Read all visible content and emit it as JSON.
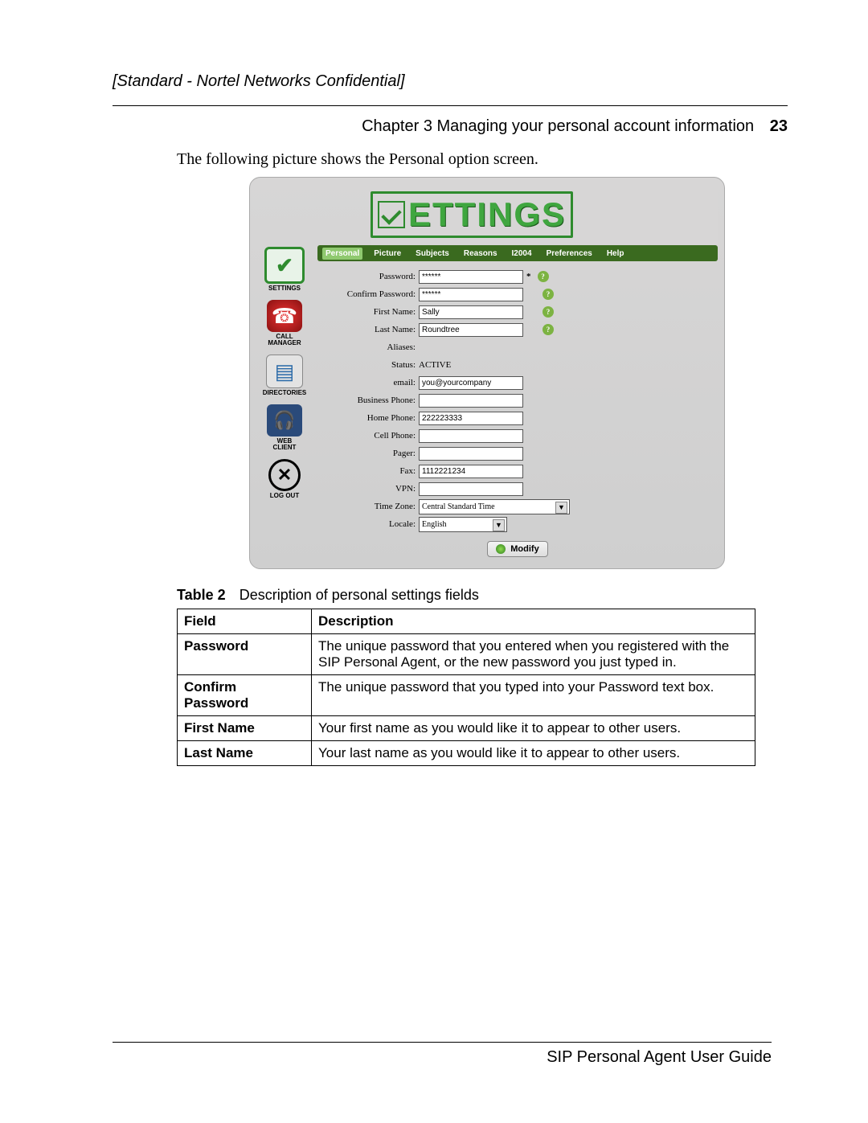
{
  "header": {
    "confidential": "[Standard - Nortel Networks Confidential]",
    "chapter_line": "Chapter 3  Managing your personal account information",
    "page_number": "23"
  },
  "intro": "The following picture shows the Personal option screen.",
  "logo_text": "ETTINGS",
  "sidebar": [
    {
      "label": "SETTINGS"
    },
    {
      "label": "CALL\nMANAGER"
    },
    {
      "label": "DIRECTORIES"
    },
    {
      "label": "WEB\nCLIENT"
    },
    {
      "label": "LOG OUT"
    }
  ],
  "tabs": [
    "Personal",
    "Picture",
    "Subjects",
    "Reasons",
    "I2004",
    "Preferences",
    "Help"
  ],
  "form": {
    "password": {
      "label": "Password:",
      "value": "******"
    },
    "confirm": {
      "label": "Confirm Password:",
      "value": "******"
    },
    "first": {
      "label": "First Name:",
      "value": "Sally"
    },
    "last": {
      "label": "Last Name:",
      "value": "Roundtree"
    },
    "aliases": {
      "label": "Aliases:",
      "value": ""
    },
    "status": {
      "label": "Status:",
      "value": "ACTIVE"
    },
    "email": {
      "label": "email:",
      "value": "you@yourcompany"
    },
    "business": {
      "label": "Business Phone:",
      "value": ""
    },
    "home": {
      "label": "Home Phone:",
      "value": "222223333"
    },
    "cell": {
      "label": "Cell Phone:",
      "value": ""
    },
    "pager": {
      "label": "Pager:",
      "value": ""
    },
    "fax": {
      "label": "Fax:",
      "value": "1112221234"
    },
    "vpn": {
      "label": "VPN:",
      "value": ""
    },
    "timezone": {
      "label": "Time Zone:",
      "value": "Central Standard Time"
    },
    "locale": {
      "label": "Locale:",
      "value": "English"
    },
    "modify": "Modify"
  },
  "table": {
    "caption_bold": "Table 2",
    "caption_rest": "Description of personal settings fields",
    "head": {
      "c1": "Field",
      "c2": "Description"
    },
    "rows": [
      {
        "field": "Password",
        "desc": "The unique password that you entered when you registered with the SIP Personal Agent, or the new password you just typed in."
      },
      {
        "field": "Confirm Password",
        "desc": "The unique password that you typed into your Password text box."
      },
      {
        "field": "First Name",
        "desc": "Your first name as you would like it to appear to other users."
      },
      {
        "field": "Last Name",
        "desc": "Your last name as you would like it to appear to other users."
      }
    ]
  },
  "footer": "SIP Personal Agent User Guide"
}
